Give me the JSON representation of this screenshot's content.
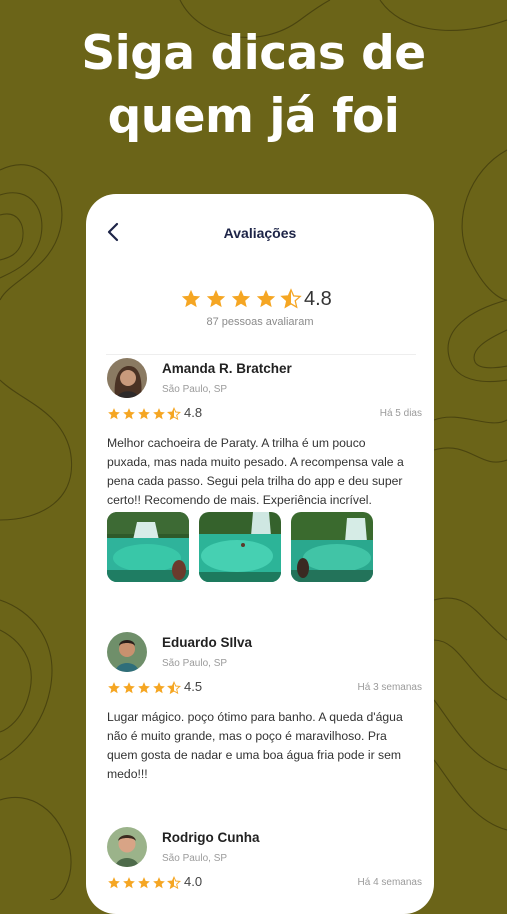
{
  "headline": {
    "line1": "Siga dicas de",
    "line2": "quem já foi"
  },
  "screen": {
    "title": "Avaliações",
    "summary": {
      "rating": "4.8",
      "stars": 4.5,
      "count_text": "87 pessoas avaliaram"
    }
  },
  "reviews": [
    {
      "name": "Amanda R. Bratcher",
      "location": "São Paulo, SP",
      "rating": "4.8",
      "time": "Há 5 dias",
      "text": "Melhor cachoeira de Paraty. A trilha é um pouco puxada, mas nada muito pesado. A recompensa vale a pena cada passo. Segui pela trilha do app e deu super certo!! Recomendo de mais. Experiência incrível.",
      "photos": [
        "waterfall-photo",
        "waterfall-photo",
        "waterfall-photo"
      ]
    },
    {
      "name": "Eduardo SIlva",
      "location": "São Paulo, SP",
      "rating": "4.5",
      "time": "Há 3 semanas",
      "text": "Lugar mágico. poço ótimo para banho. A queda d'água não é muito grande, mas o poço é maravilhoso. Pra quem gosta de nadar e uma boa água fria pode ir sem medo!!!"
    },
    {
      "name": "Rodrigo Cunha",
      "location": "São Paulo, SP",
      "rating": "4.0",
      "time": "Há 4 semanas"
    }
  ],
  "colors": {
    "background": "#6b6418",
    "star": "#f5a623",
    "title": "#1d2447"
  }
}
